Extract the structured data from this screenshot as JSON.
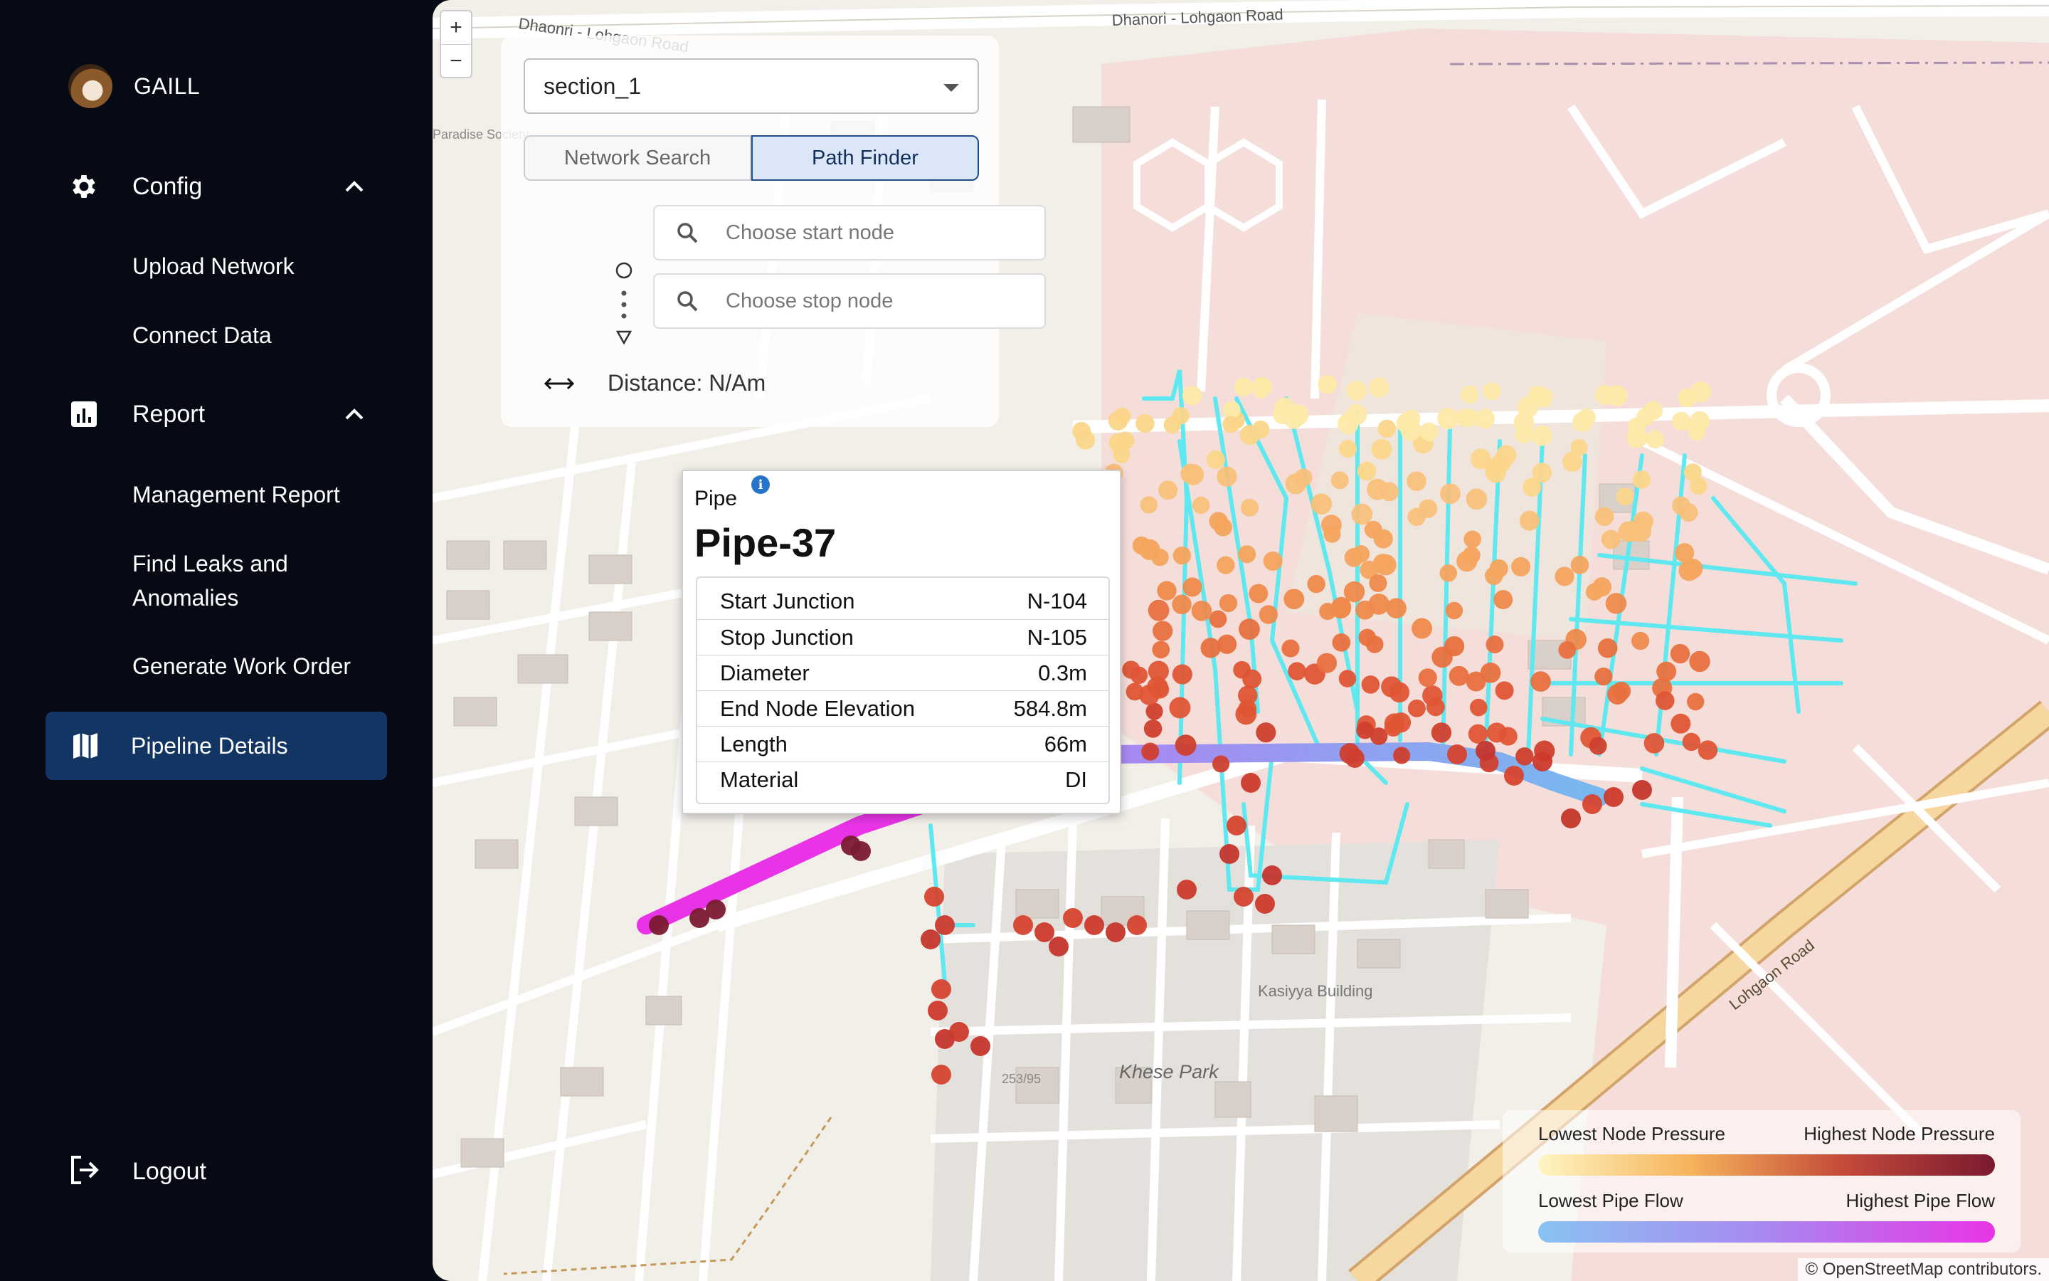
{
  "app": {
    "user_name": "GAILL"
  },
  "sidebar": {
    "config": {
      "label": "Config",
      "items": [
        "Upload Network",
        "Connect Data"
      ]
    },
    "report": {
      "label": "Report",
      "items": [
        "Management Report",
        "Find Leaks and Anomalies",
        "Generate Work Order"
      ]
    },
    "active_item": "Pipeline Details",
    "logout": "Logout"
  },
  "map": {
    "zoom_in": "+",
    "zoom_out": "−",
    "attribution_prefix": "© ",
    "attribution_link": "OpenStreetMap",
    "attribution_suffix": " contributors.",
    "labels": {
      "road1": "Dhanori - Lohgaon Road",
      "road2": "Dhaonri - Lohgaon Road",
      "road3": "Lohgaon Road",
      "park": "Khese Park",
      "building": "Kasiyya Building",
      "plot": "253/95",
      "society": "Paradise Society"
    }
  },
  "panel": {
    "section_select": "section_1",
    "tabs": [
      "Network Search",
      "Path Finder"
    ],
    "active_tab": "Path Finder",
    "start_placeholder": "Choose start node",
    "stop_placeholder": "Choose stop node",
    "distance": "Distance: N/Am"
  },
  "tooltip": {
    "kind": "Pipe",
    "info_icon": "i",
    "title": "Pipe-37",
    "rows": [
      {
        "key": "Start Junction",
        "value": "N-104"
      },
      {
        "key": "Stop Junction",
        "value": "N-105"
      },
      {
        "key": "Diameter",
        "value": "0.3m"
      },
      {
        "key": "End Node Elevation",
        "value": "584.8m"
      },
      {
        "key": "Length",
        "value": "66m"
      },
      {
        "key": "Material",
        "value": "DI"
      }
    ]
  },
  "legend": {
    "pressure_low": "Lowest Node Pressure",
    "pressure_high": "Highest Node Pressure",
    "flow_low": "Lowest Pipe Flow",
    "flow_high": "Highest Pipe Flow",
    "colors": {
      "pressure_gradient": [
        "#fff6c4",
        "#f5b35a",
        "#c44a3a",
        "#7a1a30"
      ],
      "flow_gradient": [
        "#8ac2f2",
        "#a888f0",
        "#e834e6"
      ]
    }
  },
  "icons": {
    "config": "gear-icon",
    "report": "report-chart-icon",
    "pipeline": "map-icon",
    "logout": "logout-icon",
    "search": "search-icon",
    "distance": "double-arrow-icon"
  }
}
